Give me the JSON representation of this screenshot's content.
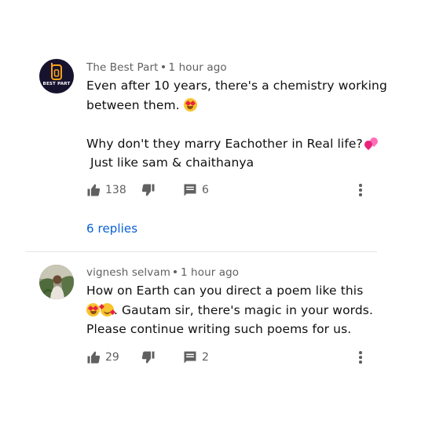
{
  "comments": [
    {
      "author": "The Best Part",
      "time": "1 hour ago",
      "avatar_text": "BEST PART",
      "avatar_icon": "best-part-logo",
      "lines": [
        "Even after 10 years, there's a chemistry working",
        "between them. ",
        "",
        "Why don't they marry Eachother in Real life?",
        " Just like sam & chaithanya"
      ],
      "likes": "138",
      "replies_count": "6",
      "replies_label": "6 replies"
    },
    {
      "author": "vignesh selvam",
      "time": "1 hour ago",
      "lines": [
        "How on Earth can you direct a poem like this",
        ". Gautam sir, there's magic in your words.",
        "Please continue writing such poems for us."
      ],
      "likes": "29",
      "replies_count": "2"
    }
  ],
  "colors": {
    "text": "#0f0f0f",
    "secondary": "#606060",
    "link": "#065fd4",
    "divider": "#e5e5e5",
    "avatar_bg": "#17122e",
    "avatar_accent": "#f7a21b"
  },
  "icons": {
    "like": "thumbs-up-icon",
    "dislike": "thumbs-down-icon",
    "reply": "reply-comment-icon",
    "more": "more-vertical-icon"
  }
}
